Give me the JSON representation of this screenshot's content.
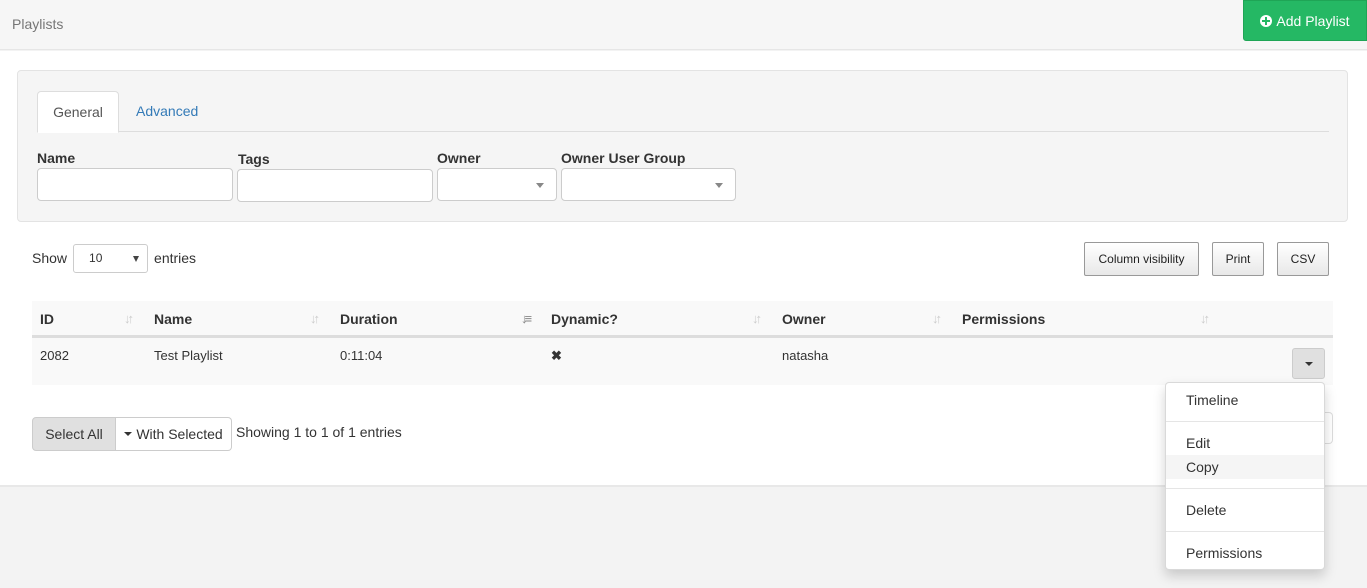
{
  "header": {
    "title": "Playlists",
    "add_button": "Add Playlist",
    "accent": "#25b864"
  },
  "filters": {
    "tabs": [
      {
        "label": "General",
        "active": true
      },
      {
        "label": "Advanced",
        "active": false
      }
    ],
    "fields": {
      "name": {
        "label": "Name",
        "value": ""
      },
      "tags": {
        "label": "Tags",
        "value": ""
      },
      "owner": {
        "label": "Owner",
        "value": ""
      },
      "owner_user_group": {
        "label": "Owner User Group",
        "value": ""
      }
    }
  },
  "table_controls": {
    "show_label": "Show",
    "entries_label": "entries",
    "page_length": "10",
    "buttons": [
      "Column visibility",
      "Print",
      "CSV"
    ]
  },
  "table": {
    "columns": [
      "ID",
      "Name",
      "Duration",
      "Dynamic?",
      "Owner",
      "Permissions"
    ],
    "sorted_column": "Duration",
    "rows": [
      {
        "id": "2082",
        "name": "Test Playlist",
        "duration": "0:11:04",
        "dynamic": "✖",
        "owner": "natasha",
        "permissions": ""
      }
    ]
  },
  "footer": {
    "select_all": "Select All",
    "with_selected": "With Selected",
    "info": "Showing 1 to 1 of 1 entries"
  },
  "row_menu": {
    "items": [
      "Timeline",
      "Edit",
      "Copy",
      "Delete",
      "Permissions"
    ],
    "hovered": "Copy"
  }
}
